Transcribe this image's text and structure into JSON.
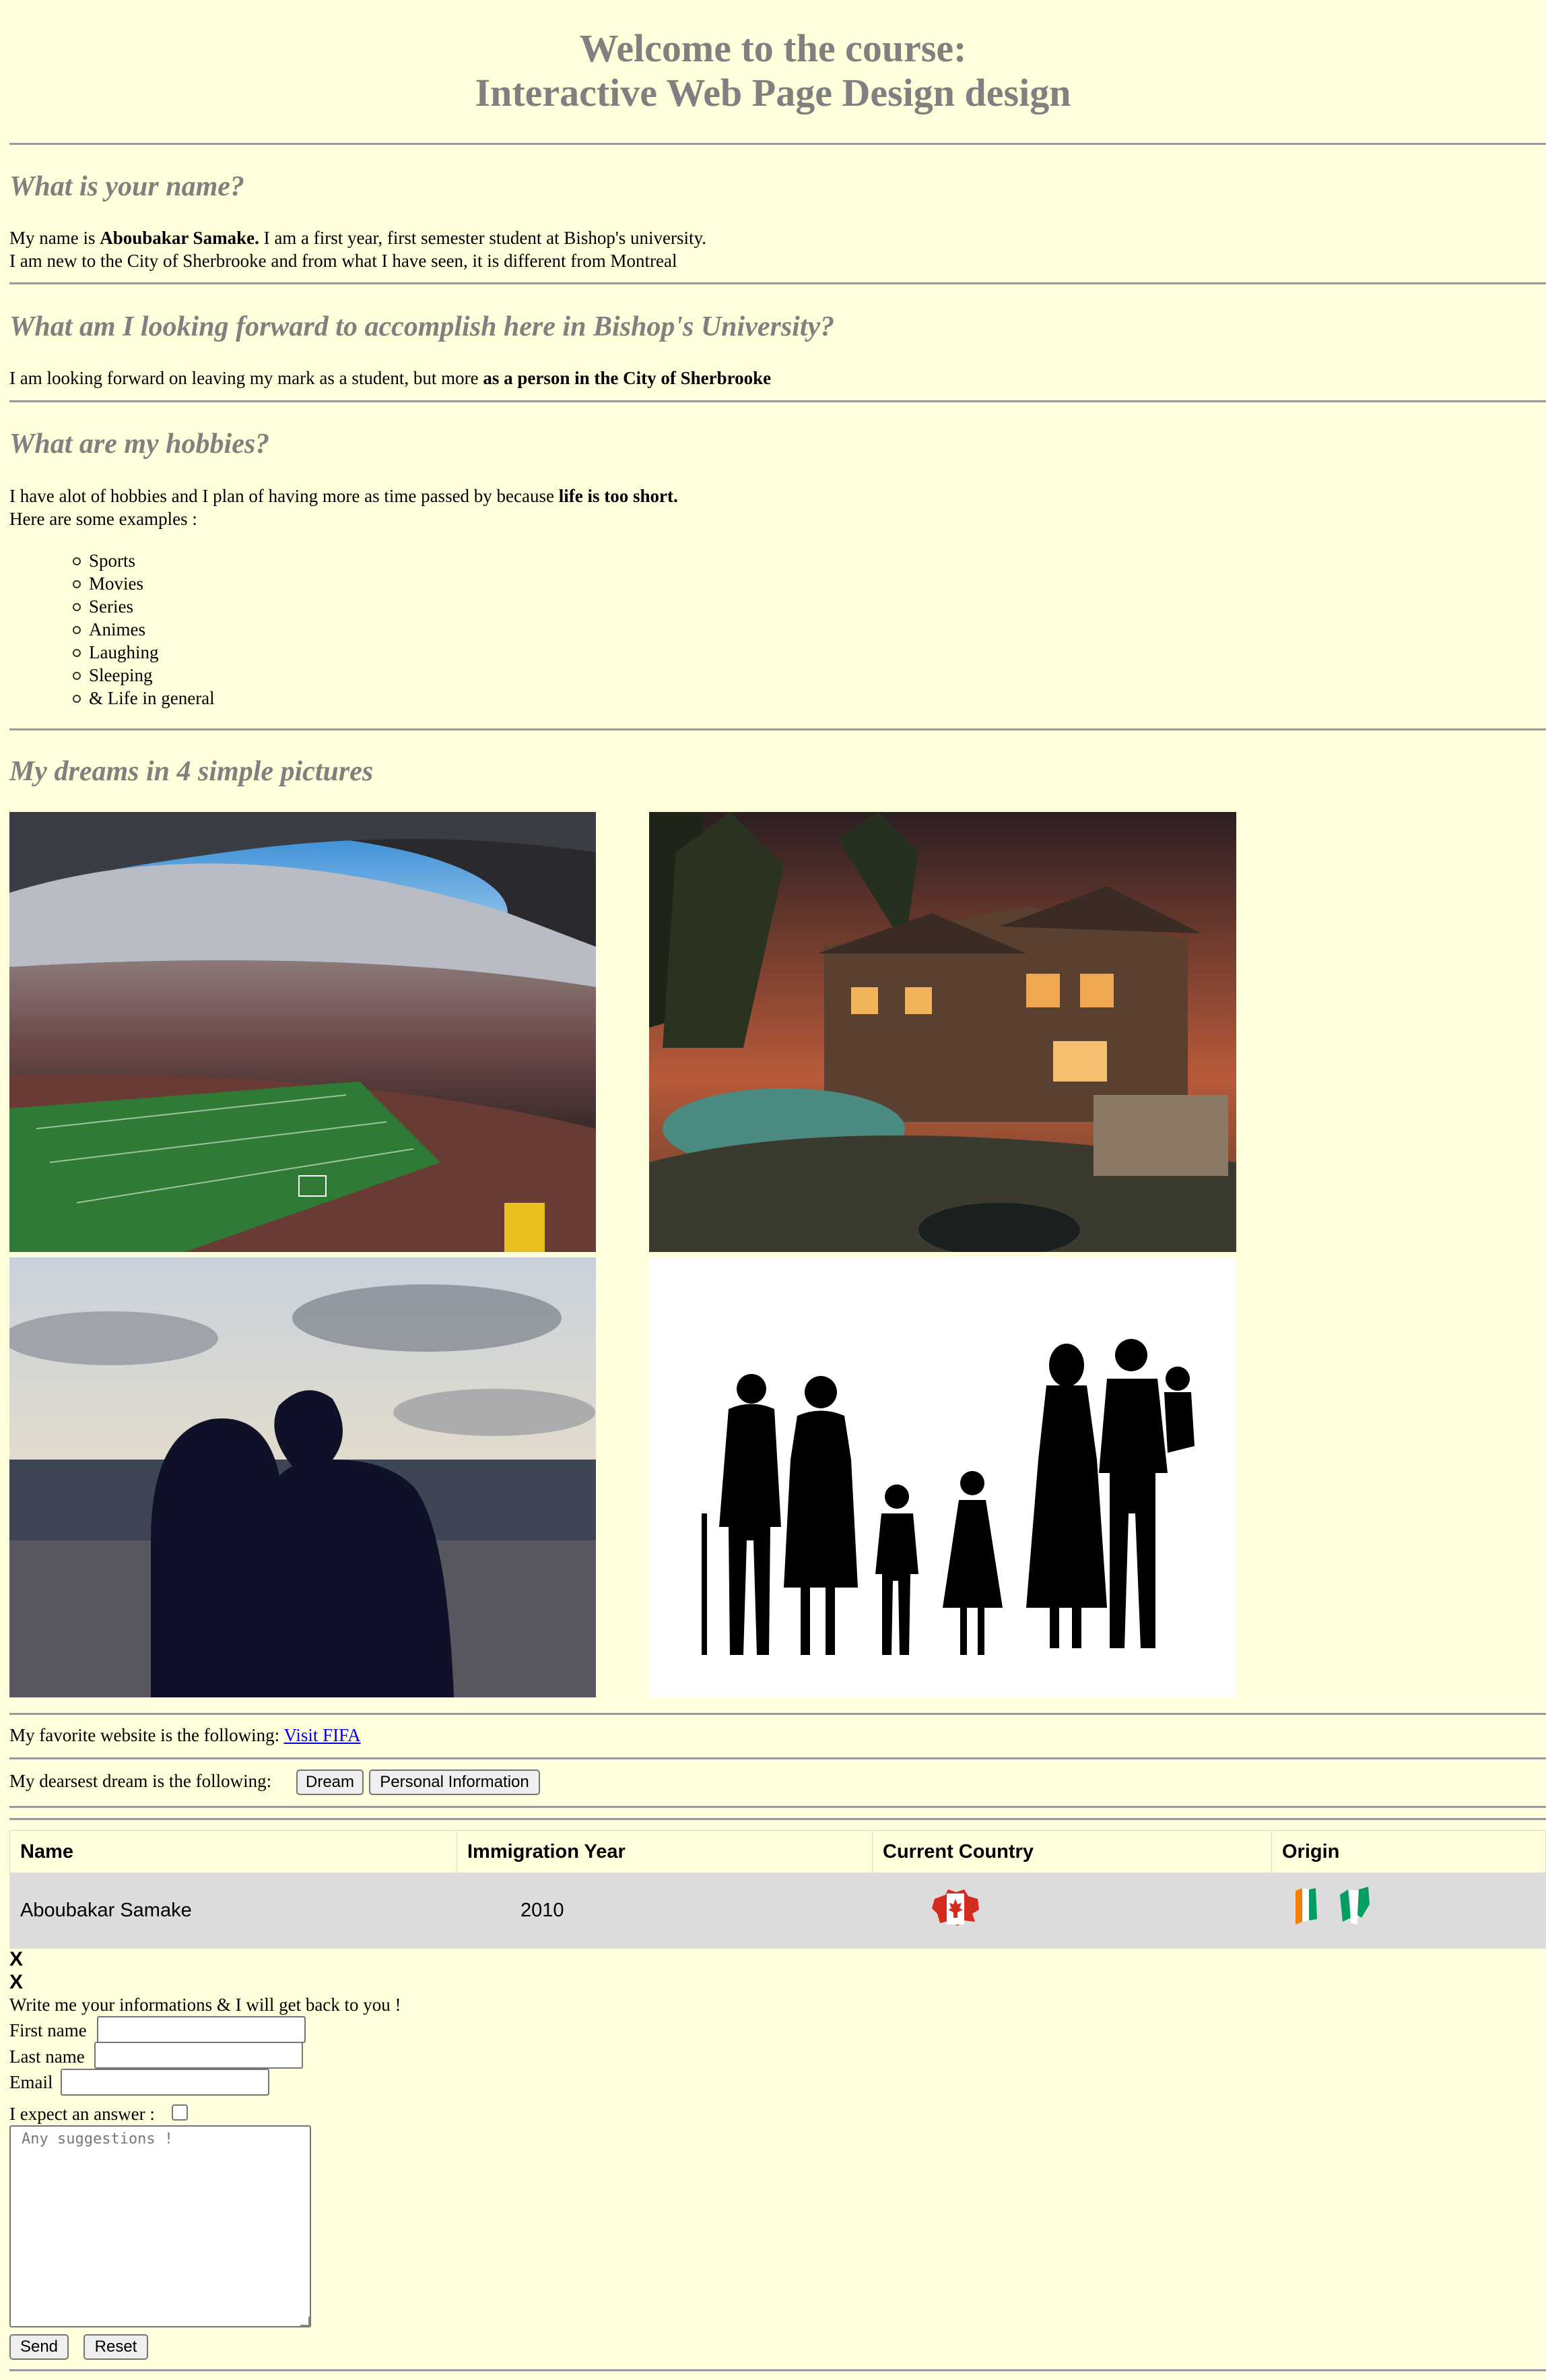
{
  "header": {
    "title_line1": "Welcome to the course:",
    "title_line2": "Interactive Web Page Design design"
  },
  "name_section": {
    "heading": "What is your name?",
    "line1_prefix": "My name is ",
    "line1_bold": "Aboubakar Samake.",
    "line1_suffix": " I am a first year, first semester student at Bishop's university.",
    "line2": "I am new to the City of Sherbrooke and from what I have seen, it is different from Montreal"
  },
  "goal_section": {
    "heading": "What am I looking forward to accomplish here in Bishop's University?",
    "text_prefix": "I am looking forward on leaving my mark as a student, but more ",
    "text_bold": "as a person in the City of Sherbrooke"
  },
  "hobbies_section": {
    "heading": "What are my hobbies?",
    "line1_prefix": "I have alot of hobbies and I plan of having more as time passed by because ",
    "line1_bold": "life is too short.",
    "line2": "Here are some examples :",
    "items": [
      "Sports",
      "Movies",
      "Series",
      "Animes",
      "Laughing",
      "Sleeping",
      "& Life in general"
    ]
  },
  "dreams_section": {
    "heading": "My dreams in 4 simple pictures",
    "images": [
      "stadium-photo",
      "mansion-photo",
      "couple-beach-photo",
      "family-silhouette-image"
    ]
  },
  "favorite_site": {
    "prefix": "My favorite website is the following: ",
    "link_label": "Visit FIFA"
  },
  "dream_buttons": {
    "prefix": "My dearsest dream is the following: ",
    "dream_label": "Dream",
    "personal_label": "Personal Information"
  },
  "table": {
    "headers": [
      "Name",
      "Immigration Year",
      "Current Country",
      "Origin"
    ],
    "row": {
      "name": "Aboubakar Samake",
      "year": "2010",
      "current_country_icon": "canada-flag-map-icon",
      "origin_icon": "ivory-coast-flag-map-icon"
    }
  },
  "close_marks": [
    "X",
    "X"
  ],
  "form": {
    "intro": "Write me your informations & I will get back to you !",
    "first_name_label": "First name",
    "last_name_label": "Last name",
    "email_label": "Email",
    "expect_label": "I expect an answer :",
    "textarea_placeholder": "Any suggestions !",
    "send_label": "Send",
    "reset_label": "Reset"
  },
  "colors": {
    "page_background": "#ffffdc",
    "heading_gray": "#808080",
    "table_row_bg": "#dcdcdc",
    "link_blue": "#0000ee"
  }
}
